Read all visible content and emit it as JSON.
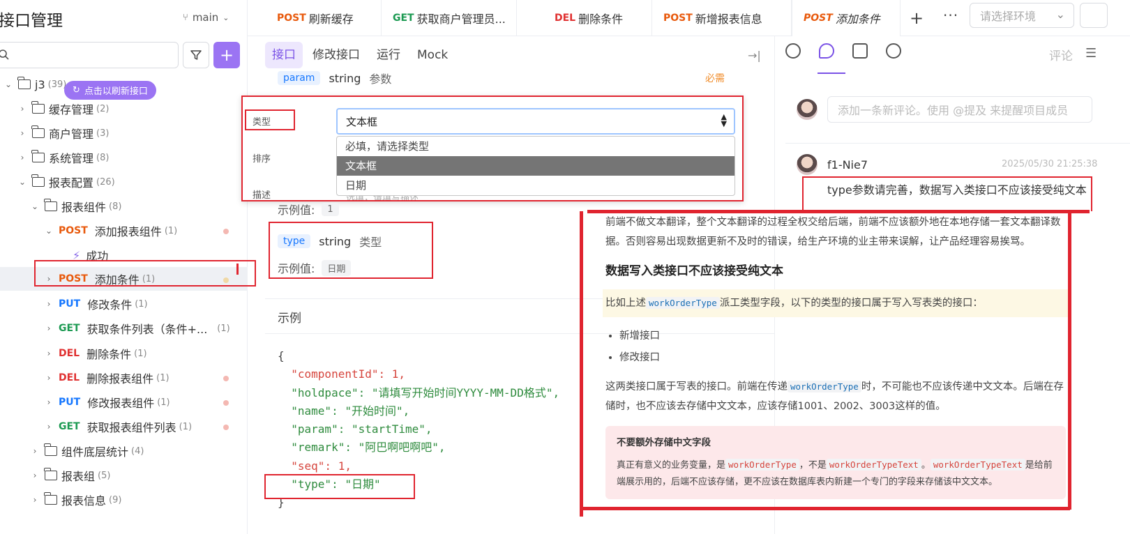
{
  "sidebar": {
    "title": "接口管理",
    "branch": "main",
    "refresh_chip": "点击以刷新接口",
    "tree": [
      {
        "label": "j3",
        "count": "(39)"
      },
      {
        "label": "缓存管理",
        "count": "(2)"
      },
      {
        "label": "商户管理",
        "count": "(3)"
      },
      {
        "label": "系统管理",
        "count": "(8)"
      },
      {
        "label": "报表配置",
        "count": "(26)"
      },
      {
        "label": "报表组件",
        "count": "(8)"
      },
      {
        "method": "POST",
        "label": "添加报表组件",
        "count": "(1)"
      },
      {
        "label": "成功"
      },
      {
        "method": "POST",
        "label": "添加条件",
        "count": "(1)"
      },
      {
        "method": "PUT",
        "label": "修改条件",
        "count": "(1)"
      },
      {
        "method": "GET",
        "label": "获取条件列表（条件+...",
        "count": "(1)"
      },
      {
        "method": "DEL",
        "label": "删除条件",
        "count": "(1)"
      },
      {
        "method": "DEL",
        "label": "删除报表组件",
        "count": "(1)"
      },
      {
        "method": "PUT",
        "label": "修改报表组件",
        "count": "(1)"
      },
      {
        "method": "GET",
        "label": "获取报表组件列表",
        "count": "(1)"
      },
      {
        "label": "组件底层统计",
        "count": "(4)"
      },
      {
        "label": "报表组",
        "count": "(5)"
      },
      {
        "label": "报表信息",
        "count": "(9)"
      }
    ]
  },
  "tabs": [
    {
      "method": "POST",
      "label": "刷新缓存"
    },
    {
      "method": "GET",
      "label": "获取商户管理员..."
    },
    {
      "method": "DEL",
      "label": "删除条件"
    },
    {
      "method": "POST",
      "label": "新增报表信息"
    },
    {
      "method": "POST",
      "label": "添加条件"
    }
  ],
  "env_select": {
    "placeholder": "请选择环境"
  },
  "mid": {
    "tabs": [
      "接口",
      "修改接口",
      "运行",
      "Mock"
    ],
    "param_row": {
      "name": "param",
      "type": "string",
      "desc": "参数",
      "required": "必需"
    },
    "modal": {
      "label_type": "类型",
      "label_seq": "排序",
      "label_desc": "描述",
      "select_value": "文本框",
      "options": [
        "必填，请选择类型",
        "文本框",
        "日期"
      ],
      "desc_placeholder": "选填，请填写描述"
    },
    "example_label": "示例值:",
    "example_value_1": "1",
    "type_field": {
      "name": "type",
      "type": "string",
      "desc": "类型",
      "example_value": "日期"
    },
    "example_title": "示例",
    "code_lines": [
      "{",
      "  \"componentId\": 1,",
      "  \"holdpace\": \"请填写开始时间YYYY-MM-DD格式\",",
      "  \"name\": \"开始时间\",",
      "  \"param\": \"startTime\",",
      "  \"remark\": \"阿巴啊吧啊吧\",",
      "  \"seq\": 1,",
      "  \"type\": \"日期\"",
      "}"
    ]
  },
  "right": {
    "comment_tab": "评论",
    "comment_placeholder": "添加一条新评论。使用 @提及 来提醒项目成员",
    "comment": {
      "user": "f1-Nie7",
      "time": "2025/05/30 21:25:38",
      "text": "type参数请完善，数据写入类接口不应该接受纯文本"
    },
    "doc": {
      "p1": "前端不做文本翻译，整个文本翻译的过程全权交给后端，前端不应该额外地在本地存储一套文本翻译数据。否则容易出现数据更新不及时的错误，给生产环境的业主带来误解，让产品经理容易挨骂。",
      "h": "数据写入类接口不应该接受纯文本",
      "hl_pre": "比如上述",
      "hl_code": "workOrderType",
      "hl_post": "派工类型字段，以下的类型的接口属于写入写表类的接口：",
      "li1": "新增接口",
      "li2": "修改接口",
      "p2_pre": "这两类接口属于写表的接口。前端在传递",
      "p2_code": "workOrderType",
      "p2_post": "时，不可能也不应该传递中文文本。后端在存储时，也不应该去存储中文文本，应该存储1001、2002、3003这样的值。",
      "warn_title": "不要额外存储中文字段",
      "warn_a": "真正有意义的业务变量，是",
      "warn_code1": "workOrderType",
      "warn_b": "，不是",
      "warn_code2": "workOrderTypeText",
      "warn_c": "。",
      "warn_code3": "workOrderTypeText",
      "warn_d": "是给前端展示用的，后端不应该存储，更不应该在数据库表内新建一个专门的字段来存储该中文文本。"
    }
  }
}
